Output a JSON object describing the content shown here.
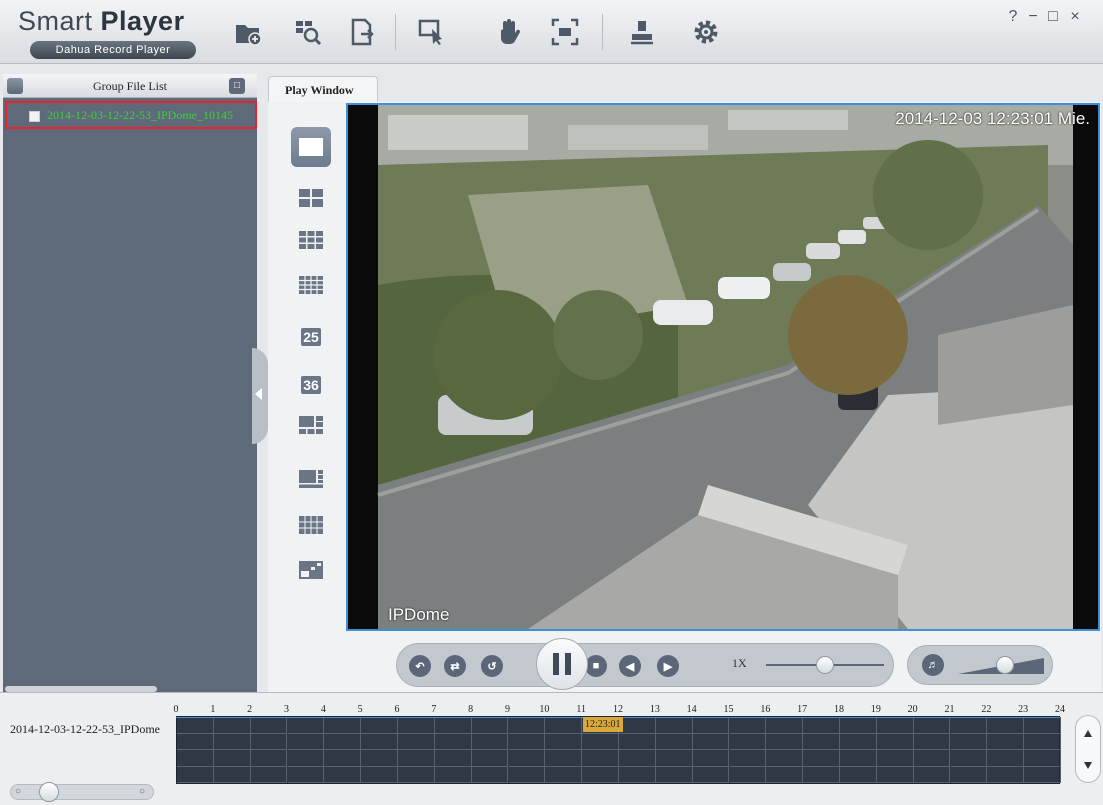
{
  "app": {
    "title": "Smart Player",
    "title_regular": "Smart ",
    "title_bold": "Player",
    "subtitle": "Dahua Record Player"
  },
  "toolbar": {
    "icons": [
      "open-folder-icon",
      "search-file-icon",
      "export-icon",
      "select-region-icon",
      "pan-hand-icon",
      "fullscreen-icon",
      "user-stamp-icon",
      "gear-icon"
    ]
  },
  "window_controls": {
    "help": "?",
    "minimize": "−",
    "maximize": "□",
    "close": "×"
  },
  "file_list": {
    "title": "Group File List",
    "items": [
      {
        "name": "2014-12-03-12-22-53_IPDome_10145"
      }
    ]
  },
  "play_window": {
    "tab_label": "Play Window",
    "split_layouts": [
      "1",
      "4",
      "9",
      "16",
      "25",
      "36",
      "custom-a",
      "custom-b",
      "custom-c",
      "custom-d"
    ],
    "split_labels": {
      "25": "25",
      "36": "36"
    },
    "video": {
      "timestamp": "2014-12-03 12:23:01 Mie.",
      "camera_name": "IPDome"
    }
  },
  "playback": {
    "speed": "1X",
    "speed_slider": 0.5,
    "volume": 0.55
  },
  "timeline": {
    "file_label": "2014-12-03-12-22-53_IPDome",
    "hours": [
      "0",
      "1",
      "2",
      "3",
      "4",
      "5",
      "6",
      "7",
      "8",
      "9",
      "10",
      "11",
      "12",
      "13",
      "14",
      "15",
      "16",
      "17",
      "18",
      "19",
      "20",
      "21",
      "22",
      "23",
      "24"
    ],
    "cursor_time": "12:23:01",
    "zoom": 0.2
  },
  "colors": {
    "selection_border": "#e8212b",
    "file_text": "#3bd13b",
    "video_border": "#3d8fd6",
    "cursor": "#d8a83a",
    "panel": "#5e6a7a"
  }
}
